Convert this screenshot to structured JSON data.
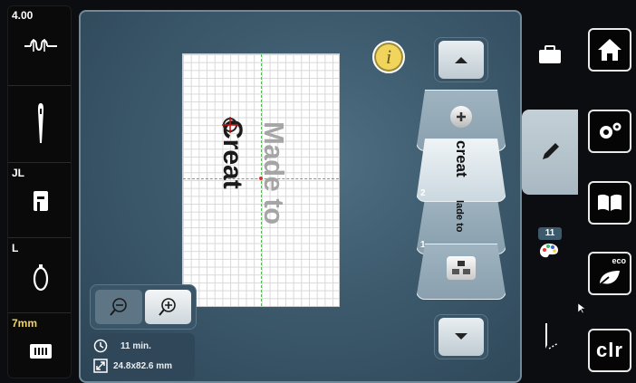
{
  "left_panel": {
    "speed_label": "4.00",
    "presser_foot_label": "JL",
    "hoop_label": "L",
    "stitch_length_label": "7mm"
  },
  "canvas": {
    "text_line1": "Made to",
    "text_line2": "Creat",
    "info_icon_glyph": "i"
  },
  "zoom": {
    "zoom_out_icon": "zoom-out-icon",
    "zoom_in_icon": "zoom-in-icon"
  },
  "stats": {
    "time": "11 min.",
    "size": "24.8x82.6 mm"
  },
  "layers": {
    "layer2_text": "creat",
    "layer1_text": "lade to",
    "layer2_number": "2",
    "layer1_number": "1"
  },
  "right_tabs": {
    "color_count": "11"
  },
  "right_nav": {
    "clr_label": "clr",
    "eco_label": "eco"
  },
  "colors": {
    "accent_yellow": "#f1d45c",
    "background": "#0b0d10",
    "workarea": "#3d5a6d"
  }
}
